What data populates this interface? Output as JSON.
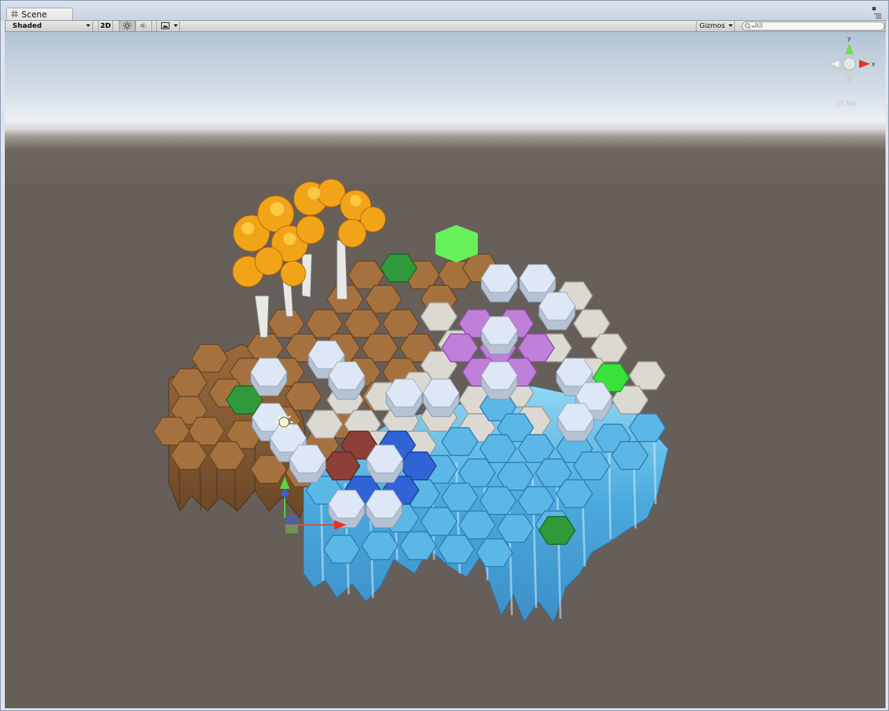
{
  "window": {
    "tab_label": "Scene",
    "tab_icon": "grid-icon"
  },
  "toolbar": {
    "shading_mode": "Shaded",
    "mode_2d_label": "2D",
    "lighting_icon": "sun-icon",
    "audio_icon": "speaker-icon",
    "effects_icon": "image-icon",
    "gizmos_label": "Gizmos",
    "search_placeholder": "All"
  },
  "scene_gizmo": {
    "projection_label": "Iso",
    "axis_y": "y",
    "axis_x": "x",
    "colors": {
      "x": "#e8332a",
      "y": "#69d93a",
      "z": "#3a63d9"
    }
  },
  "scene": {
    "description_icons": [
      "autumn-tree-icon",
      "hex-tile-icon",
      "ice-cliff-icon",
      "directional-light-icon",
      "move-gizmo-icon"
    ],
    "colors": {
      "dirt": "#9a6a3c",
      "stone": "#d9d6cf",
      "ice": "#5ab4e2",
      "ice_highlight": "#a9e0f6",
      "purple": "#b97ad6",
      "grass": "#2f9a3a",
      "bright_green": "#5af25a",
      "blue_tile": "#2f63d6",
      "red_tile": "#8e3f36",
      "snow_block": "#dde7f5",
      "foliage": "#f2a418"
    }
  }
}
